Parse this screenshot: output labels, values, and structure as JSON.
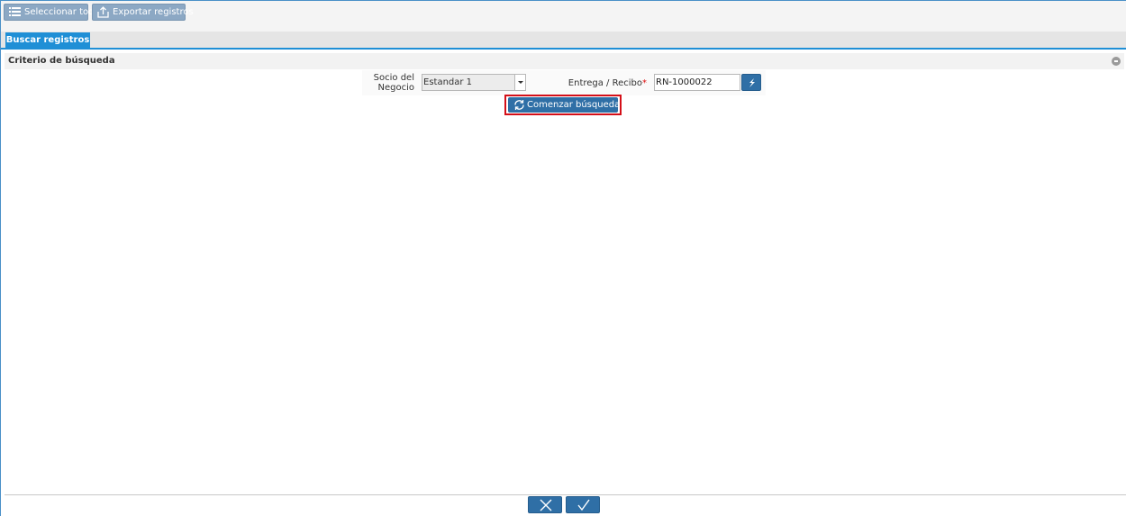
{
  "toolbar": {
    "select_all_label": "Seleccionar todo",
    "export_label": "Exportar registros"
  },
  "tabs": [
    {
      "label": "Buscar registros",
      "active": true
    }
  ],
  "section": {
    "title": "Criterio de búsqueda"
  },
  "form": {
    "socio_label": "Socio del Negocio",
    "socio_value": "Estandar 1",
    "entrega_label": "Entrega / Recibo",
    "entrega_required_mark": "*",
    "entrega_value": "RN-1000022"
  },
  "actions": {
    "start_search_label": "Comenzar búsqueda ..."
  },
  "colors": {
    "accent": "#1f8fd6",
    "button": "#2f6fa6",
    "highlight": "#d40f18"
  },
  "icons": [
    "list-icon",
    "export-icon",
    "lookup-icon",
    "refresh-icon",
    "close-icon",
    "check-icon",
    "collapse-icon"
  ]
}
